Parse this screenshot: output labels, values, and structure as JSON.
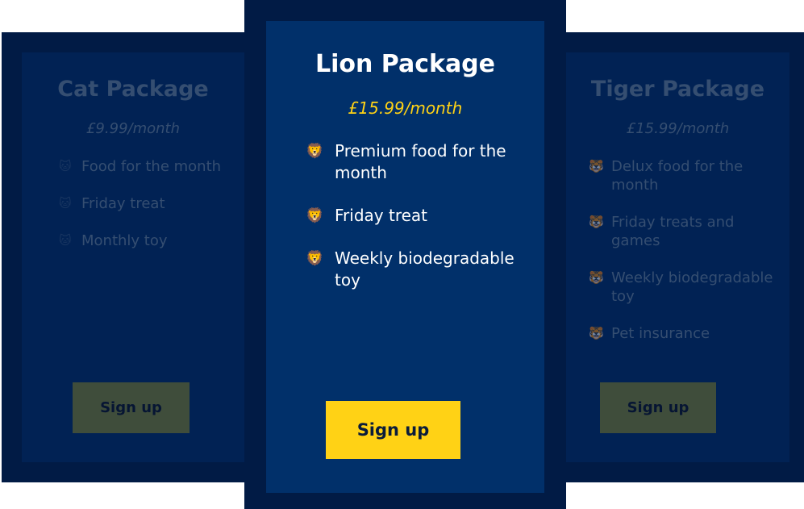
{
  "packages": {
    "cat": {
      "title": "Cat Package",
      "price": "£9.99/month",
      "feature_icon": "🐱",
      "features": [
        "Food for the month",
        "Friday treat",
        "Monthly toy"
      ],
      "cta": "Sign up"
    },
    "lion": {
      "title": "Lion Package",
      "price": "£15.99/month",
      "feature_icon": "🦁",
      "features": [
        "Premium food for the month",
        "Friday treat",
        "Weekly biodegradable toy"
      ],
      "cta": "Sign up"
    },
    "tiger": {
      "title": "Tiger Package",
      "price": "£15.99/month",
      "feature_icon": "🐯",
      "features": [
        "Delux food for the month",
        "Friday treats and games",
        "Weekly biodegradable toy",
        "Pet insurance"
      ],
      "cta": "Sign up"
    }
  },
  "colors": {
    "frame": "#011b45",
    "card": "#012254",
    "featured_card": "#01306a",
    "accent": "#ffd215",
    "dim_text": "#354e71",
    "dim_button": "#3f4d3b"
  }
}
